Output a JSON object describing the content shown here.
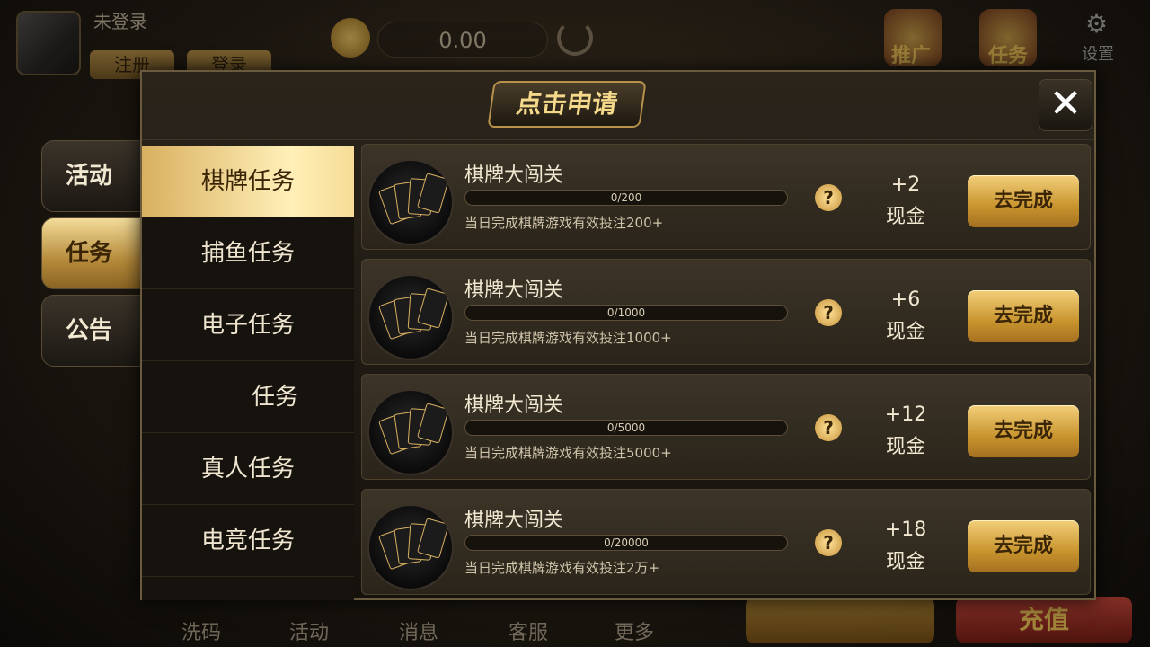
{
  "header": {
    "user_status": "未登录",
    "register_label": "注册",
    "login_label": "登录",
    "balance": "0.00",
    "promo_label": "推广",
    "task_label": "任务",
    "settings_label": "设置"
  },
  "side_tabs": [
    {
      "label": "活动",
      "active": false
    },
    {
      "label": "任务",
      "active": true
    },
    {
      "label": "公告",
      "active": false
    }
  ],
  "dialog": {
    "title": "点击申请",
    "close_symbol": "✕"
  },
  "categories": [
    {
      "label": "棋牌任务",
      "active": true
    },
    {
      "label": "捕鱼任务",
      "active": false
    },
    {
      "label": "电子任务",
      "active": false
    },
    {
      "label": "任务",
      "active": false
    },
    {
      "label": "真人任务",
      "active": false
    },
    {
      "label": "电竞任务",
      "active": false
    }
  ],
  "tasks": [
    {
      "name": "棋牌大闯关",
      "progress_text": "0/200",
      "progress_fraction": 0,
      "desc": "当日完成棋牌游戏有效投注200+",
      "reward_amount": "+2",
      "reward_type": "现金",
      "button": "去完成"
    },
    {
      "name": "棋牌大闯关",
      "progress_text": "0/1000",
      "progress_fraction": 0,
      "desc": "当日完成棋牌游戏有效投注1000+",
      "reward_amount": "+6",
      "reward_type": "现金",
      "button": "去完成"
    },
    {
      "name": "棋牌大闯关",
      "progress_text": "0/5000",
      "progress_fraction": 0,
      "desc": "当日完成棋牌游戏有效投注5000+",
      "reward_amount": "+12",
      "reward_type": "现金",
      "button": "去完成"
    },
    {
      "name": "棋牌大闯关",
      "progress_text": "0/20000",
      "progress_fraction": 0,
      "desc": "当日完成棋牌游戏有效投注2万+",
      "reward_amount": "+18",
      "reward_type": "现金",
      "button": "去完成"
    }
  ],
  "bottom_nav": [
    "洗码",
    "活动",
    "消息",
    "客服",
    "更多"
  ],
  "bottom_buttons": {
    "recharge": "充值"
  },
  "icons": {
    "coin": "coin-icon",
    "refresh": "refresh-icon",
    "settings": "gear-icon",
    "help": "question-icon",
    "close": "close-icon"
  },
  "colors": {
    "accent_gold": "#d9b060",
    "panel_bg": "#15120d",
    "button_gold": "#c8942e"
  }
}
